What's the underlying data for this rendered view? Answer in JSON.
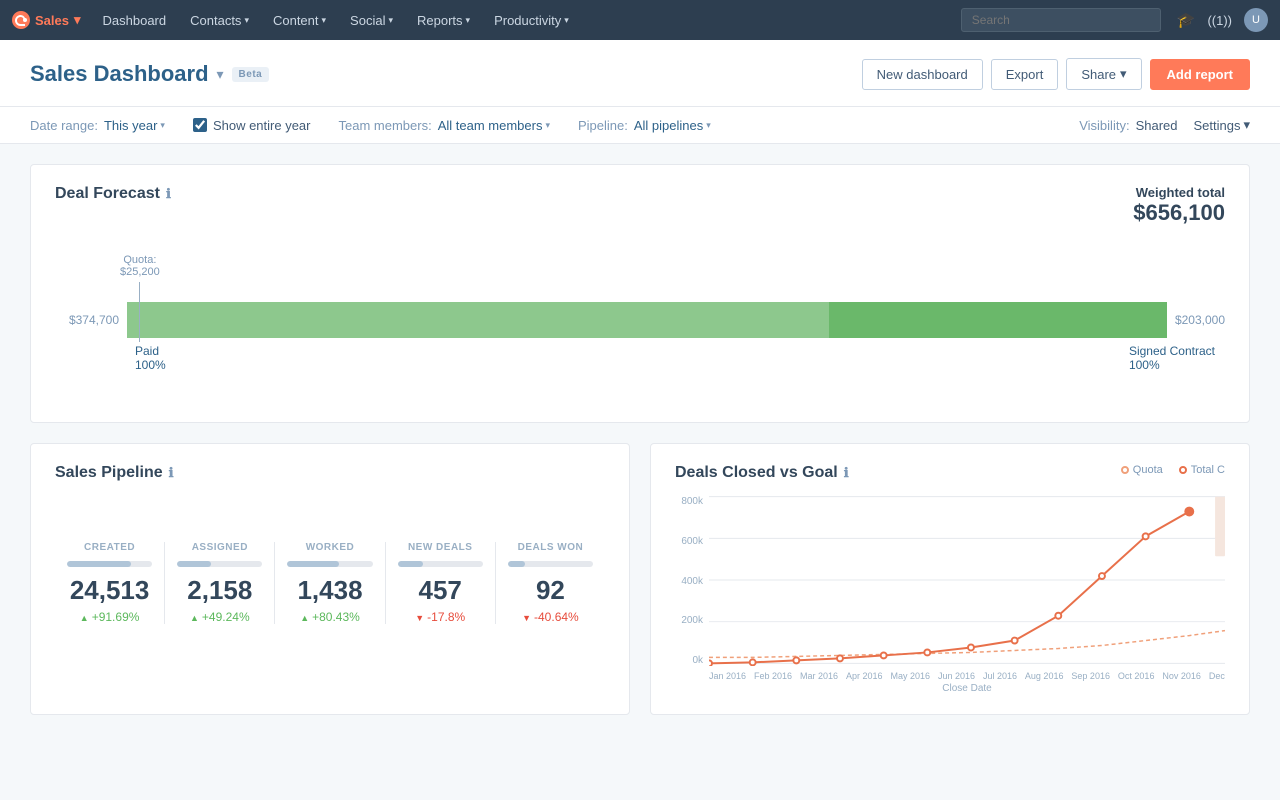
{
  "topnav": {
    "brand": "Sales",
    "items": [
      {
        "label": "Dashboard",
        "has_caret": false
      },
      {
        "label": "Contacts",
        "has_caret": true
      },
      {
        "label": "Content",
        "has_caret": true
      },
      {
        "label": "Social",
        "has_caret": true
      },
      {
        "label": "Reports",
        "has_caret": true
      },
      {
        "label": "Productivity",
        "has_caret": true
      }
    ],
    "search_placeholder": "Search"
  },
  "header": {
    "title": "Sales Dashboard",
    "beta_label": "Beta",
    "actions": {
      "new_dashboard": "New dashboard",
      "export": "Export",
      "share": "Share",
      "add_report": "Add report"
    }
  },
  "filters": {
    "date_range_label": "Date range:",
    "date_range_value": "This year",
    "show_entire_year": "Show entire year",
    "team_members_label": "Team members:",
    "team_members_value": "All team members",
    "pipeline_label": "Pipeline:",
    "pipeline_value": "All pipelines",
    "visibility_label": "Visibility:",
    "visibility_value": "Shared",
    "settings_label": "Settings"
  },
  "deal_forecast": {
    "title": "Deal Forecast",
    "weighted_total_label": "Weighted total",
    "weighted_total_value": "$656,100",
    "quota_label": "Quota:",
    "quota_value": "$25,200",
    "bar_left_value": "$374,700",
    "bar_mid_value": "$203,000",
    "paid_label": "Paid",
    "paid_pct": "100%",
    "signed_label": "Signed Contract",
    "signed_pct": "100%"
  },
  "sales_pipeline": {
    "title": "Sales Pipeline",
    "metrics": [
      {
        "label": "CREATED",
        "value": "24,513",
        "change": "+91.69%",
        "direction": "up",
        "bar_pct": 75
      },
      {
        "label": "ASSIGNED",
        "value": "2,158",
        "change": "+49.24%",
        "direction": "up",
        "bar_pct": 40
      },
      {
        "label": "WORKED",
        "value": "1,438",
        "change": "+80.43%",
        "direction": "up",
        "bar_pct": 60
      },
      {
        "label": "NEW DEALS",
        "value": "457",
        "change": "-17.8%",
        "direction": "down",
        "bar_pct": 30
      },
      {
        "label": "DEALS WON",
        "value": "92",
        "change": "-40.64%",
        "direction": "down",
        "bar_pct": 20
      }
    ]
  },
  "deals_closed": {
    "title": "Deals Closed vs Goal",
    "legend": {
      "quota": "Quota",
      "total": "Total C"
    },
    "y_axis": [
      "800k",
      "600k",
      "400k",
      "200k",
      "0k"
    ],
    "x_axis": [
      "Jan 2016",
      "Feb 2016",
      "Mar 2016",
      "Apr 2016",
      "May 2016",
      "Jun 2016",
      "Jul 2016",
      "Aug 2016",
      "Sep 2016",
      "Oct 2016",
      "Nov 2016",
      "Dec"
    ],
    "x_label": "Close Date"
  },
  "icons": {
    "info": "ℹ",
    "caret_down": "▾",
    "caret_right": "›",
    "check": "✓",
    "graduation": "🎓",
    "settings": "⚙"
  }
}
